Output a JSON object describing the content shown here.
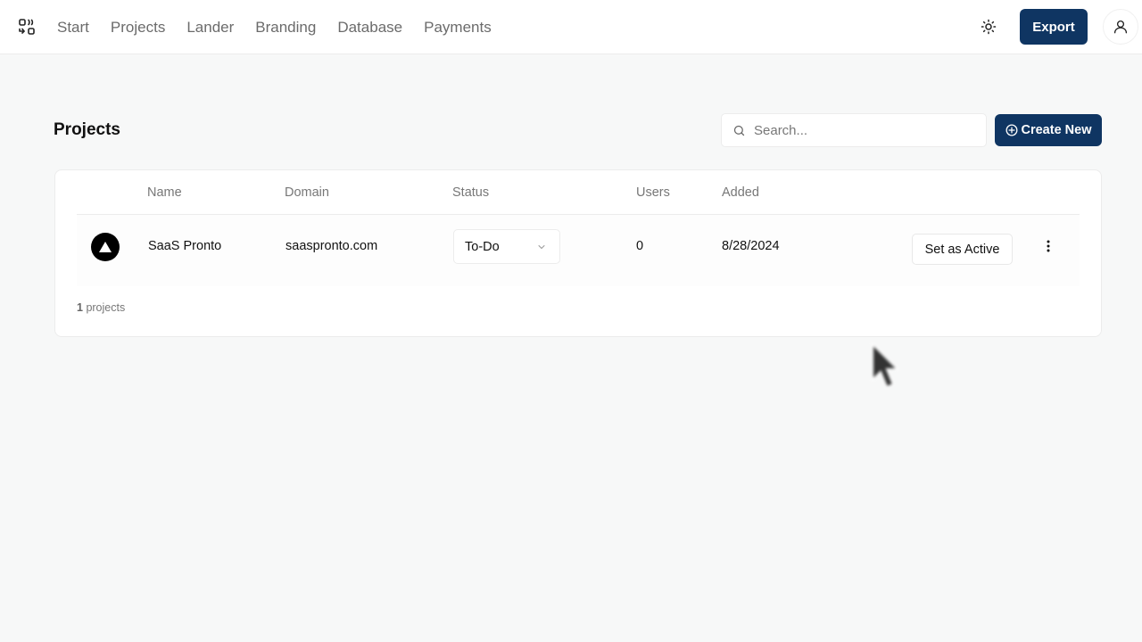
{
  "nav": {
    "logo_icon": "app-switch-icon",
    "items": [
      {
        "label": "Start"
      },
      {
        "label": "Projects"
      },
      {
        "label": "Lander"
      },
      {
        "label": "Branding"
      },
      {
        "label": "Database"
      },
      {
        "label": "Payments"
      }
    ],
    "theme_icon": "sun-icon",
    "export_label": "Export",
    "user_icon": "user-icon"
  },
  "page": {
    "title": "Projects",
    "search_placeholder": "Search...",
    "create_label": "Create New"
  },
  "table": {
    "columns": [
      "Name",
      "Domain",
      "Status",
      "Users",
      "Added"
    ],
    "rows": [
      {
        "avatar_icon": "triangle-logo-icon",
        "name": "SaaS Pronto",
        "domain": "saaspronto.com",
        "status": "To-Do",
        "users": "0",
        "added": "8/28/2024",
        "action_label": "Set as Active"
      }
    ],
    "footer": {
      "count": "1",
      "suffix": "projects"
    }
  },
  "colors": {
    "primary": "#0f3562",
    "background": "#f7f8f8"
  }
}
